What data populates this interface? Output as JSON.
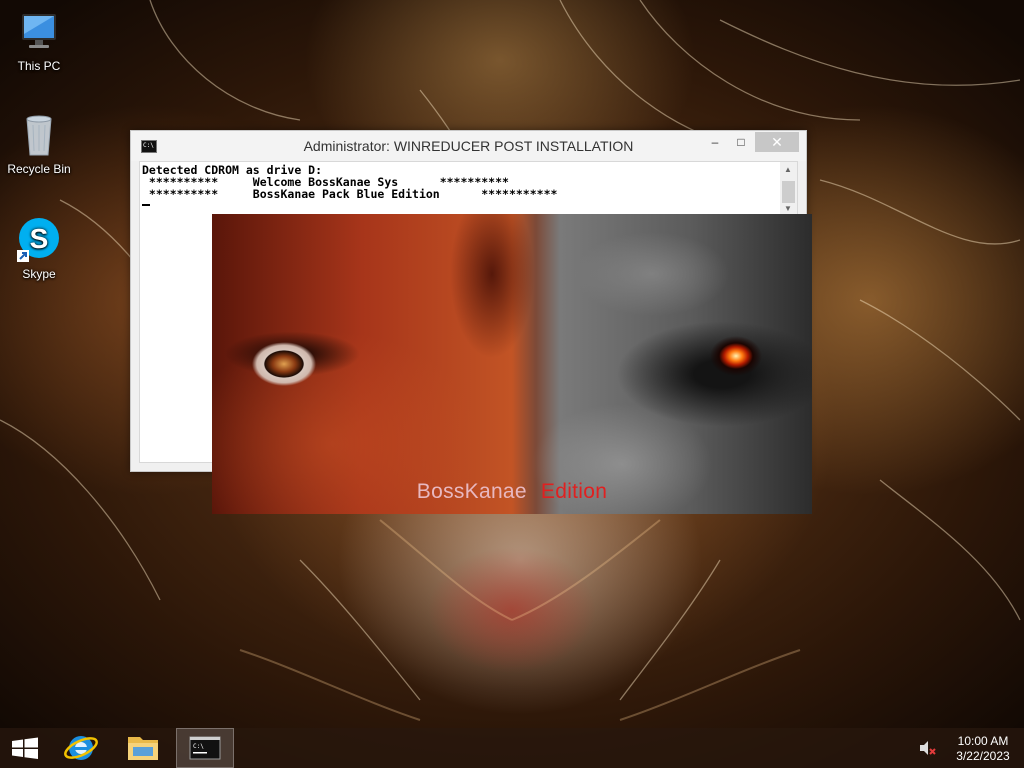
{
  "desktop": {
    "icons": [
      {
        "label": "This PC",
        "icon": "computer-icon"
      },
      {
        "label": "Recycle Bin",
        "icon": "recycle-bin-icon"
      },
      {
        "label": "Skype",
        "icon": "skype-icon"
      }
    ]
  },
  "console": {
    "title": "Administrator:  WINREDUCER POST INSTALLATION",
    "controls": {
      "minimize": "–",
      "maximize": "□",
      "close": "✕"
    },
    "lines": [
      "Detected CDROM as drive D:",
      " **********     Welcome BossKanae Sys      **********",
      " **********     BossKanae Pack Blue Edition      ***********"
    ]
  },
  "splash": {
    "caption_word1": "BossKanae",
    "caption_word2": "Edition"
  },
  "taskbar": {
    "pinned": [
      {
        "name": "start-button",
        "icon": "windows-logo-icon"
      },
      {
        "name": "internet-explorer",
        "icon": "ie-icon"
      },
      {
        "name": "file-explorer",
        "icon": "folder-icon"
      },
      {
        "name": "command-prompt",
        "icon": "cmd-icon",
        "active": true
      }
    ],
    "tray": {
      "volume": "muted",
      "time": "10:00 AM",
      "date": "3/22/2023"
    }
  },
  "colors": {
    "caption_word1": "#e8b8c0",
    "caption_word2": "#e02020",
    "close_button": "#c7c7c7"
  }
}
